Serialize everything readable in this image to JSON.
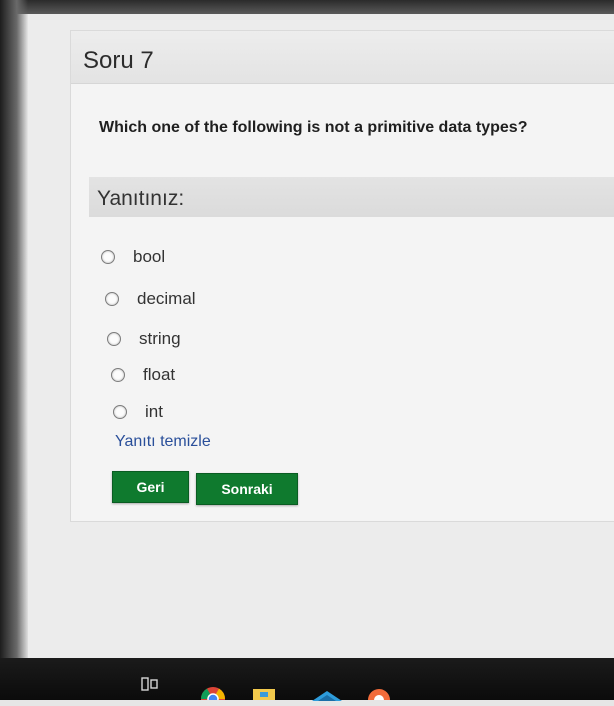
{
  "question": {
    "title": "Soru 7",
    "text": "Which one of the following is not a primitive data types?"
  },
  "answers": {
    "header": "Yanıtınız:",
    "options": [
      {
        "label": "bool"
      },
      {
        "label": "decimal"
      },
      {
        "label": "string"
      },
      {
        "label": "float"
      },
      {
        "label": "int"
      }
    ],
    "clear_label": "Yanıtı temizle"
  },
  "buttons": {
    "back_label": "Geri",
    "next_label": "Sonraki"
  },
  "colors": {
    "button_green": "#0f7a2e",
    "link_blue": "#2a4f9a"
  },
  "taskbar": {
    "icons": [
      "task-view-icon",
      "chrome-icon",
      "file-explorer-icon",
      "mail-icon",
      "app-icon"
    ]
  }
}
